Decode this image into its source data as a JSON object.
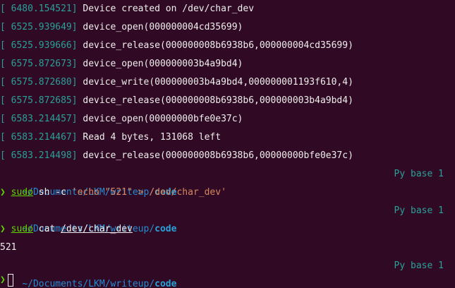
{
  "log_lines": [
    {
      "ts": "[ 6480.154521]",
      "msg": " Device created on /dev/char_dev"
    },
    {
      "ts": "[ 6525.939649]",
      "msg": " device_open(000000004cd35699)"
    },
    {
      "ts": "[ 6525.939666]",
      "msg": " device_release(000000008b6938b6,000000004cd35699)"
    },
    {
      "ts": "[ 6575.872673]",
      "msg": " device_open(000000003b4a9bd4)"
    },
    {
      "ts": "[ 6575.872680]",
      "msg": " device_write(000000003b4a9bd4,000000001193f610,4)"
    },
    {
      "ts": "[ 6575.872685]",
      "msg": " device_release(000000008b6938b6,000000003b4a9bd4)"
    },
    {
      "ts": "[ 6583.214457]",
      "msg": " device_open(00000000bfe0e37c)"
    },
    {
      "ts": "[ 6583.214467]",
      "msg": " Read 4 bytes, 131068 left"
    },
    {
      "ts": "[ 6583.214498]",
      "msg": " device_release(000000008b6938b6,00000000bfe0e37c)"
    }
  ],
  "prompt": {
    "path_prefix": "~/Documents/LKM/writeup/",
    "path_dir": "code",
    "right_status": "Py base 1",
    "arrow": "❯"
  },
  "cmd1": {
    "cmd": "sudo",
    "args": " sh -c ",
    "str": "'echo \"521\" > /dev/char_dev'"
  },
  "cmd2": {
    "cmd": "sudo",
    "args": " cat ",
    "path": "/dev/char_dev"
  },
  "output": "521"
}
